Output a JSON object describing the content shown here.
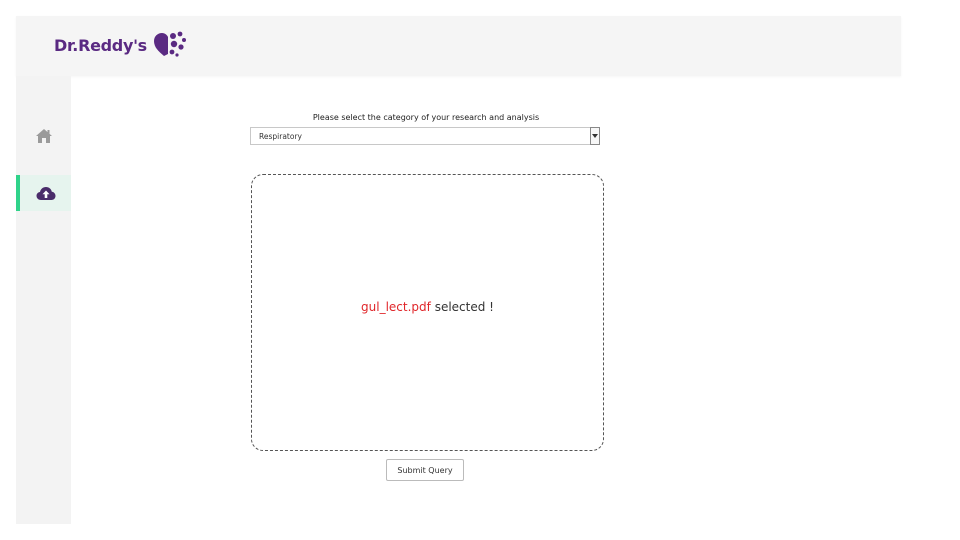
{
  "header": {
    "logo_text": "Dr.Reddy's",
    "logo_mark": "heart-dots-logo"
  },
  "sidebar": {
    "items": [
      {
        "icon": "home-icon",
        "active": false
      },
      {
        "icon": "cloud-upload-icon",
        "active": true
      }
    ],
    "active_accent": "#2fd38a",
    "icon_color_active": "#4a2c6a",
    "icon_color_inactive": "#9a9a9a"
  },
  "form": {
    "prompt": "Please select the category of your research and analysis",
    "category_selected": "Respiratory",
    "dropzone": {
      "filename": "gul_lect.pdf",
      "status": " selected !"
    },
    "submit_label": "Submit Query"
  },
  "colors": {
    "brand": "#5a2a82",
    "filename": "#e0262a"
  }
}
